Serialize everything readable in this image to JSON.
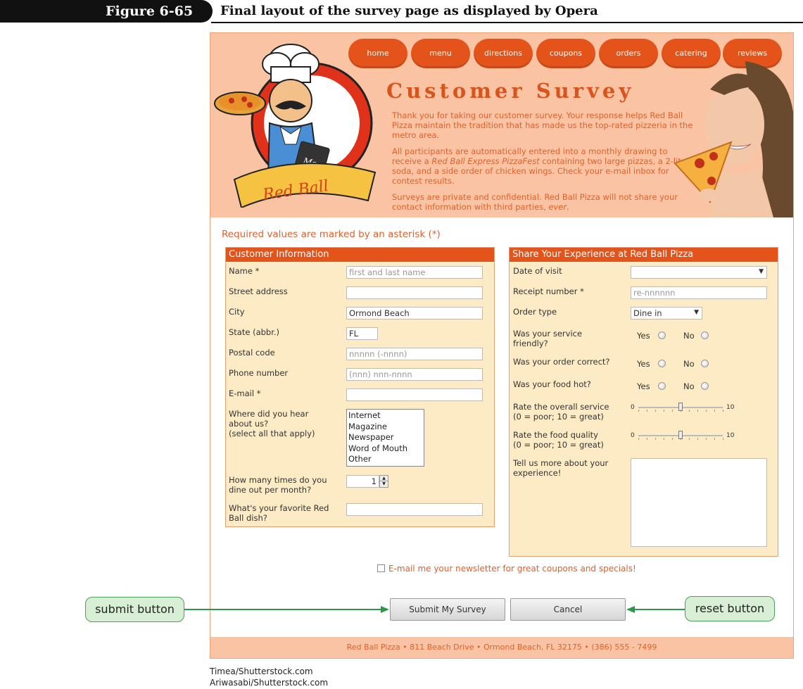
{
  "figure": {
    "number": "Figure 6-65",
    "title": "Final layout of the survey page as displayed by Opera"
  },
  "nav": [
    "home",
    "menu",
    "directions",
    "coupons",
    "orders",
    "catering",
    "reviews"
  ],
  "banner": {
    "logo_text": "Red Ball",
    "menu_text": "Menu",
    "title": "Customer Survey",
    "para1": "Thank you for taking our customer survey. Your response helps Red Ball Pizza maintain the tradition that has made us the top-rated pizzeria in the metro area.",
    "para2_a": "All participants are automatically entered into a monthly drawing to receive a ",
    "para2_em": "Red Ball Express PizzaFest",
    "para2_b": " containing two large pizzas, a 2-liter soda, and a side order of chicken wings. Check your e-mail inbox for contest results.",
    "para3_a": "Surveys are private and confidential. Red Ball Pizza will not share your contact information with third parties, ",
    "para3_em": "ever",
    "para3_b": "."
  },
  "required_note": "Required values are marked by an asterisk (*)",
  "customer": {
    "legend": "Customer Information",
    "name_label": "Name *",
    "name_placeholder": "first and last name",
    "street_label": "Street address",
    "city_label": "City",
    "city_value": "Ormond Beach",
    "state_label": "State (abbr.)",
    "state_value": "FL",
    "postal_label": "Postal code",
    "postal_placeholder": "nnnnn (-nnnn)",
    "phone_label": "Phone number",
    "phone_placeholder": "(nnn) nnn-nnnn",
    "email_label": "E-mail *",
    "hear_label_1": "Where did you hear",
    "hear_label_2": "about us?",
    "hear_label_3": "(select all that apply)",
    "hear_options": [
      "Internet",
      "Magazine",
      "Newspaper",
      "Word of Mouth",
      "Other"
    ],
    "dine_label_1": "How many times do you",
    "dine_label_2": "dine out per month?",
    "dine_value": "1",
    "dish_label_1": "What's your favorite Red",
    "dish_label_2": "Ball dish?"
  },
  "experience": {
    "legend": "Share Your Experience at Red Ball Pizza",
    "date_label": "Date of visit",
    "receipt_label": "Receipt number *",
    "receipt_placeholder": "re-nnnnnn",
    "order_label": "Order type",
    "order_value": "Dine in",
    "friendly_label_1": "Was your service",
    "friendly_label_2": "friendly?",
    "correct_label": "Was your order correct?",
    "hot_label": "Was your food hot?",
    "yes": "Yes",
    "no": "No",
    "service_label_1": "Rate the overall service",
    "service_label_2": "(0 = poor; 10 = great)",
    "food_label_1": "Rate the food quality",
    "food_label_2": "(0 = poor; 10 = great)",
    "slider_min": "0",
    "slider_max": "10",
    "service_value": 5,
    "food_value": 5,
    "tell_label_1": "Tell us more about your",
    "tell_label_2": "experience!"
  },
  "newsletter_label": "E-mail me your newsletter for great coupons and specials!",
  "buttons": {
    "submit": "Submit My Survey",
    "reset": "Cancel"
  },
  "footer": "Red Ball Pizza • 811 Beach Drive • Ormond Beach, FL 32175 • (386) 555 - 7499",
  "callouts": {
    "submit": "submit button",
    "reset": "reset button"
  },
  "credits": [
    "Timea/Shutterstock.com",
    "Ariwasabi/Shutterstock.com"
  ],
  "colors": {
    "accent": "#e4541a",
    "banner": "#fac4a4",
    "fieldset": "#fcebc4",
    "callout_green": "#4aa05a"
  }
}
